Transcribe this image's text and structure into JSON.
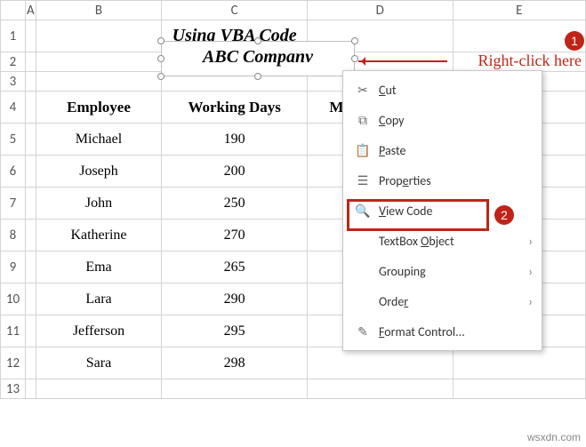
{
  "title": "Using VBA Code",
  "textbox": "ABC Companv",
  "columns": [
    "A",
    "B",
    "C",
    "D",
    "E"
  ],
  "rows": [
    "1",
    "2",
    "3",
    "4",
    "5",
    "6",
    "7",
    "8",
    "9",
    "10",
    "11",
    "12",
    "13"
  ],
  "table": {
    "headers": [
      "Employee",
      "Working Days",
      "Monthly Salary"
    ],
    "data": [
      {
        "emp": "Michael",
        "days": "190"
      },
      {
        "emp": "Joseph",
        "days": "200"
      },
      {
        "emp": "John",
        "days": "250"
      },
      {
        "emp": "Katherine",
        "days": "270"
      },
      {
        "emp": "Ema",
        "days": "265"
      },
      {
        "emp": "Lara",
        "days": "290"
      },
      {
        "emp": "Jefferson",
        "days": "295"
      },
      {
        "emp": "Sara",
        "days": "298"
      }
    ]
  },
  "menu": {
    "cut": "Cut",
    "copy": "Copy",
    "paste": "Paste",
    "properties": "Properties",
    "viewcode": "View Code",
    "textboxobj": "TextBox Object",
    "grouping": "Grouping",
    "order": "Order",
    "formatcontrol": "Format Control..."
  },
  "annotation": {
    "num1": "1",
    "num2": "2",
    "text": "Right-click here"
  },
  "watermark": "wsxdn.com"
}
